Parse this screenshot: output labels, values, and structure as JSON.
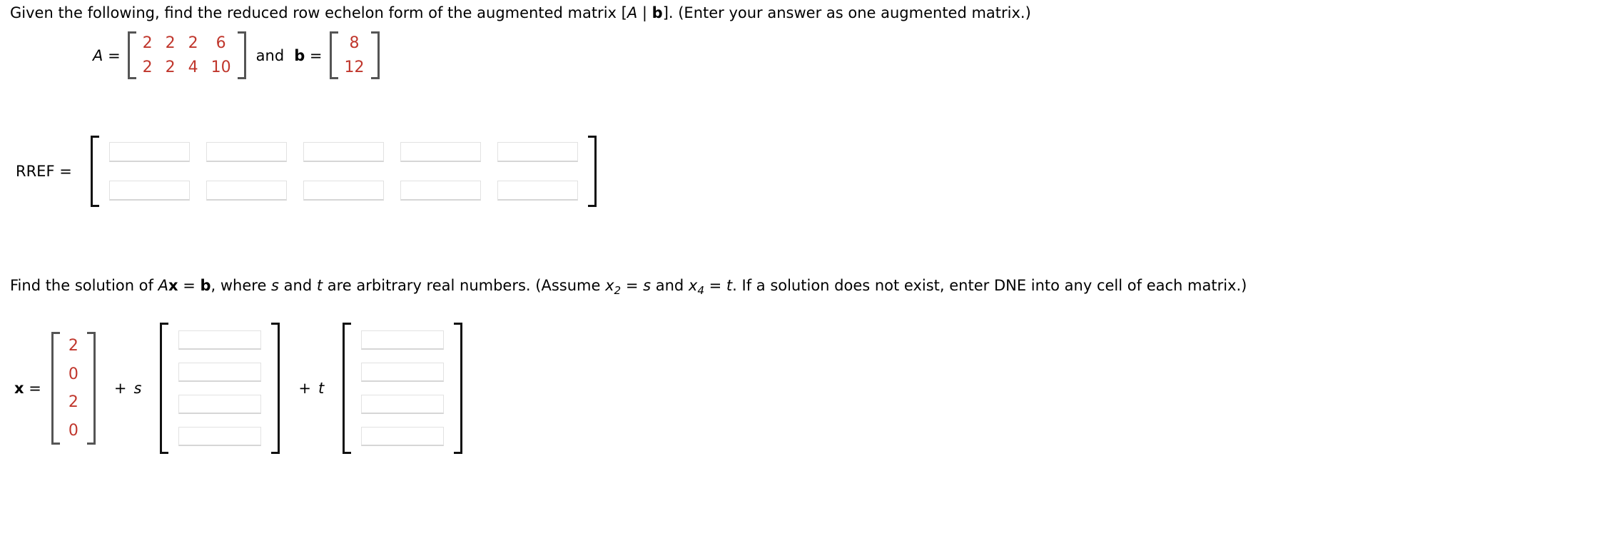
{
  "question1": {
    "text_parts": {
      "p1": "Given the following, find the reduced row echelon form of the augmented matrix [",
      "a": "A",
      "bar": " | ",
      "b": "b",
      "p2": "]. (Enter your answer as one augmented matrix.)"
    },
    "given": {
      "a_label": "A",
      "a_equals": "=",
      "matrix_a": {
        "rows": 2,
        "cols": 4,
        "values": [
          [
            "2",
            "2",
            "2",
            "6"
          ],
          [
            "2",
            "2",
            "4",
            "10"
          ]
        ]
      },
      "conjunction": "and",
      "b_label": "b",
      "b_equals": "=",
      "vector_b": {
        "rows": 2,
        "cols": 1,
        "values": [
          [
            "8"
          ],
          [
            "12"
          ]
        ]
      }
    },
    "answer": {
      "label": "RREF =",
      "rows": 2,
      "cols": 5,
      "cells": [
        [
          "",
          "",
          "",
          "",
          ""
        ],
        [
          "",
          "",
          "",
          "",
          ""
        ]
      ],
      "placeholder": ""
    }
  },
  "question2": {
    "text_parts": {
      "p1": "Find the solution of  ",
      "a": "A",
      "x": "x",
      "eq": " = ",
      "b": "b",
      "p2": ",  where ",
      "s": "s",
      "p3": " and ",
      "t": "t",
      "p4": " are arbitrary real numbers. (Assume  ",
      "x2": "x",
      "x2sub": "2",
      "p5": " = ",
      "s2": "s",
      "p6": "  and  ",
      "x4": "x",
      "x4sub": "4",
      "p7": " = ",
      "t2": "t",
      "p8": ".  If a solution does not exist, enter DNE into any cell of each matrix.)"
    },
    "solution": {
      "x_label": "x",
      "x_equals": "=",
      "particular_vector": {
        "rows": 4,
        "cols": 1,
        "values": [
          [
            "2"
          ],
          [
            "0"
          ],
          [
            "2"
          ],
          [
            "0"
          ]
        ]
      },
      "plus_s": "+",
      "s_var": "s",
      "s_vector": {
        "rows": 4,
        "cols": 1,
        "cells": [
          [
            ""
          ],
          [
            ""
          ],
          [
            ""
          ],
          [
            ""
          ]
        ]
      },
      "plus_t": "+",
      "t_var": "t",
      "t_vector": {
        "rows": 4,
        "cols": 1,
        "cells": [
          [
            ""
          ],
          [
            ""
          ],
          [
            ""
          ],
          [
            ""
          ]
        ]
      },
      "placeholder": ""
    }
  },
  "colors": {
    "red_value": "#C0362C",
    "text": "#000000",
    "bracket_gray": "#555555",
    "bracket_dark": "#111111",
    "input_border": "#E2E2E2",
    "background": "#FFFFFF"
  }
}
